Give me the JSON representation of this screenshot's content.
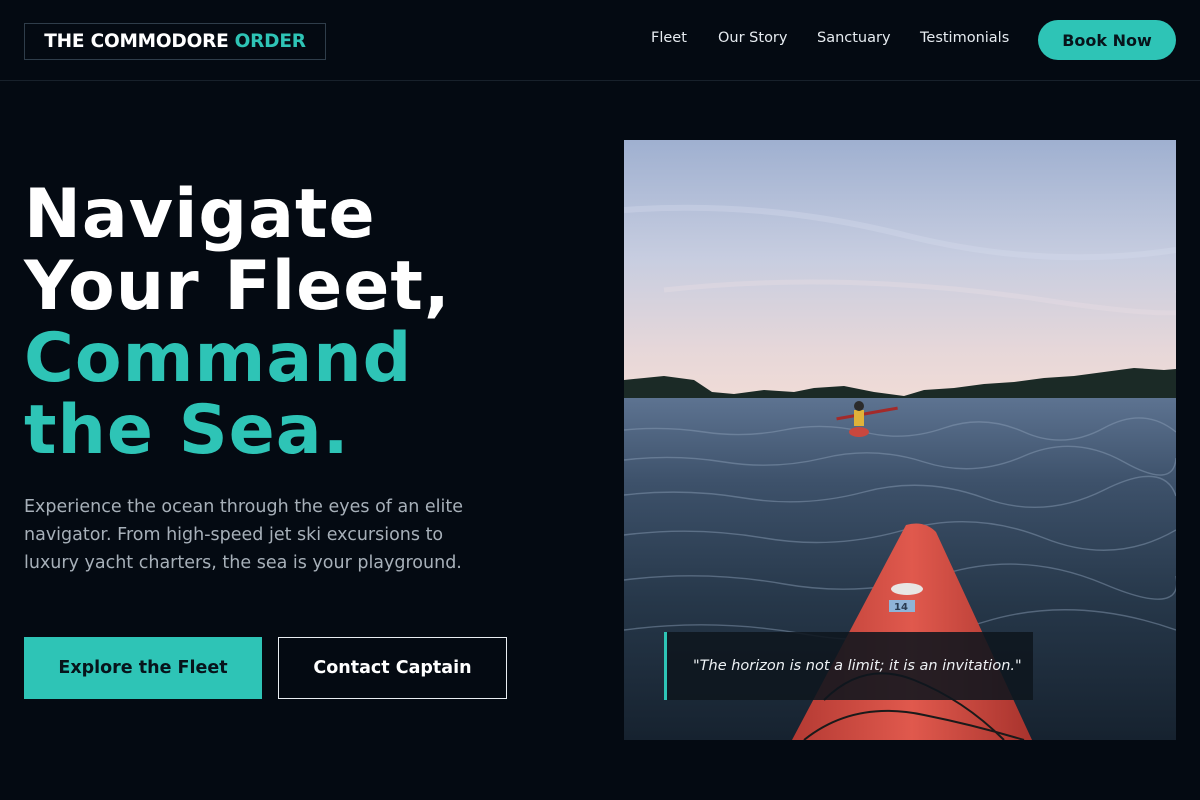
{
  "header": {
    "logo": {
      "text": "THE COMMODORE",
      "accent": "ORDER"
    },
    "nav": [
      "Fleet",
      "Our Story",
      "Sanctuary",
      "Testimonials"
    ],
    "cta": "Book Now"
  },
  "hero": {
    "title_lines": [
      "Navigate",
      "Your Fleet,"
    ],
    "title_accent_lines": [
      "Command",
      "the Sea."
    ],
    "subtitle": "Experience the ocean through the eyes of an elite navigator. From high-speed jet ski excursions to luxury yacht charters, the sea is your playground.",
    "primary_button": "Explore the Fleet",
    "secondary_button": "Contact Captain",
    "image": {
      "subject": "kayak-on-lake-at-sunset",
      "kayak_number": "14"
    },
    "quote": "\"The horizon is not a limit; it is an invitation.\""
  },
  "colors": {
    "background": "#040a12",
    "accent": "#2ec4b6",
    "text": "#ffffff",
    "muted_text": "#a7b0b9",
    "kayak": "#d9534a"
  }
}
